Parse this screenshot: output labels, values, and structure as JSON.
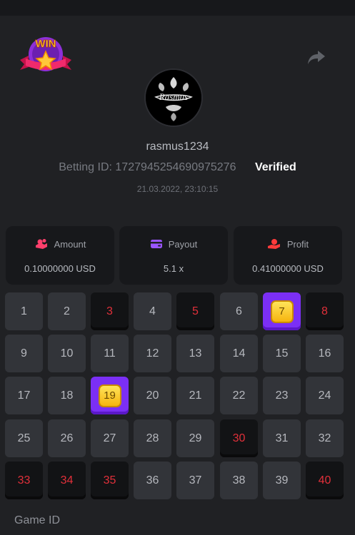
{
  "badge": {
    "text": "WIN"
  },
  "user": {
    "username": "rasmus1234",
    "avatar_text": "Rasmus",
    "betting_id_label": "Betting ID:",
    "betting_id": "1727945254690975276",
    "verified": "Verified",
    "datetime": "21.03.2022, 23:10:15"
  },
  "stats": {
    "amount": {
      "label": "Amount",
      "value": "0.10000000 USD"
    },
    "payout": {
      "label": "Payout",
      "value": "5.1 x"
    },
    "profit": {
      "label": "Profit",
      "value": "0.41000000 USD"
    }
  },
  "grid": {
    "cells": [
      {
        "n": "1",
        "s": "normal"
      },
      {
        "n": "2",
        "s": "normal"
      },
      {
        "n": "3",
        "s": "miss"
      },
      {
        "n": "4",
        "s": "normal"
      },
      {
        "n": "5",
        "s": "miss"
      },
      {
        "n": "6",
        "s": "normal"
      },
      {
        "n": "7",
        "s": "hit"
      },
      {
        "n": "8",
        "s": "miss"
      },
      {
        "n": "9",
        "s": "normal"
      },
      {
        "n": "10",
        "s": "normal"
      },
      {
        "n": "11",
        "s": "normal"
      },
      {
        "n": "12",
        "s": "normal"
      },
      {
        "n": "13",
        "s": "normal"
      },
      {
        "n": "14",
        "s": "normal"
      },
      {
        "n": "15",
        "s": "normal"
      },
      {
        "n": "16",
        "s": "normal"
      },
      {
        "n": "17",
        "s": "normal"
      },
      {
        "n": "18",
        "s": "normal"
      },
      {
        "n": "19",
        "s": "hit"
      },
      {
        "n": "20",
        "s": "normal"
      },
      {
        "n": "21",
        "s": "normal"
      },
      {
        "n": "22",
        "s": "normal"
      },
      {
        "n": "23",
        "s": "normal"
      },
      {
        "n": "24",
        "s": "normal"
      },
      {
        "n": "25",
        "s": "normal"
      },
      {
        "n": "26",
        "s": "normal"
      },
      {
        "n": "27",
        "s": "normal"
      },
      {
        "n": "28",
        "s": "normal"
      },
      {
        "n": "29",
        "s": "normal"
      },
      {
        "n": "30",
        "s": "miss"
      },
      {
        "n": "31",
        "s": "normal"
      },
      {
        "n": "32",
        "s": "normal"
      },
      {
        "n": "33",
        "s": "miss"
      },
      {
        "n": "34",
        "s": "miss"
      },
      {
        "n": "35",
        "s": "miss"
      },
      {
        "n": "36",
        "s": "normal"
      },
      {
        "n": "37",
        "s": "normal"
      },
      {
        "n": "38",
        "s": "normal"
      },
      {
        "n": "39",
        "s": "normal"
      },
      {
        "n": "40",
        "s": "miss"
      }
    ]
  },
  "footer": {
    "game_id_label": "Game ID"
  },
  "colors": {
    "accent": "#7b2ff5",
    "miss": "#e2303a",
    "gem": "#f6b40e",
    "background": "#202124"
  },
  "icons": {
    "share": "share-icon",
    "amount": "coins-icon",
    "payout": "wallet-icon",
    "profit": "hand-coin-icon",
    "gem": "gem-icon"
  }
}
